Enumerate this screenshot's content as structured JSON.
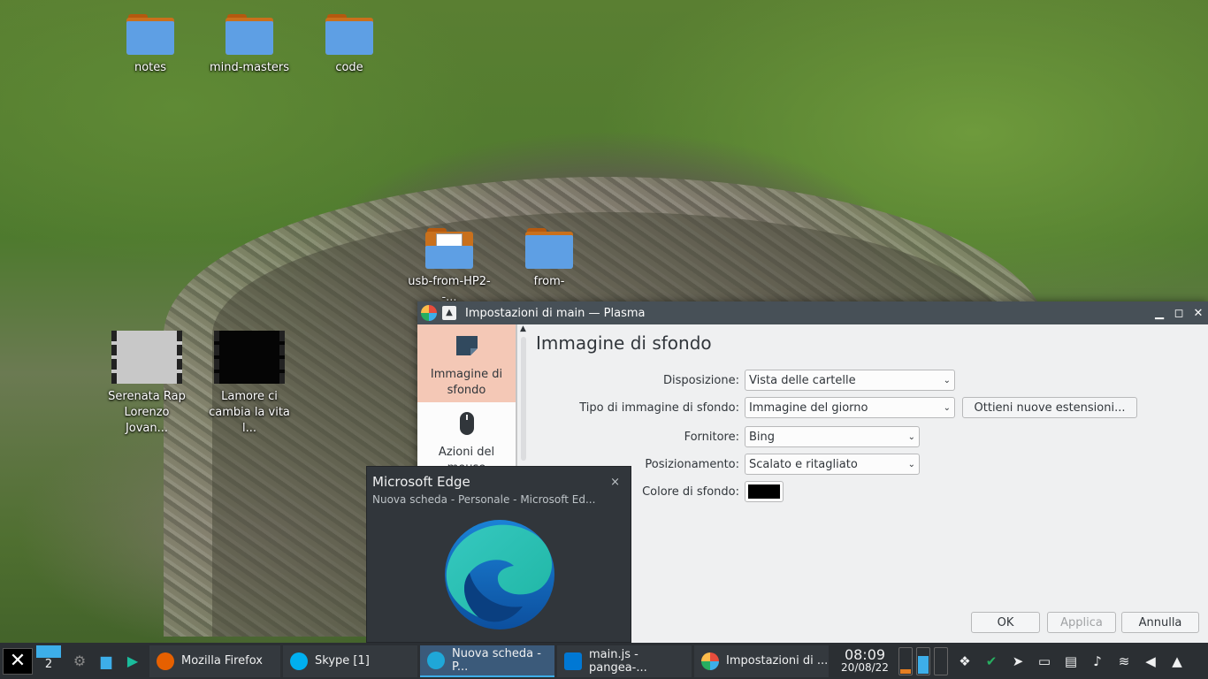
{
  "desktop": {
    "icons": [
      {
        "label": "notes"
      },
      {
        "label": "mind-masters"
      },
      {
        "label": "code"
      },
      {
        "label": "usb-from-HP2--..."
      },
      {
        "label": "from-"
      },
      {
        "label": "Serenata Rap Lorenzo Jovan..."
      },
      {
        "label": "Lamore ci cambia la vita l..."
      }
    ]
  },
  "window": {
    "title": "Impostazioni di main — Plasma",
    "sidebar": [
      {
        "label": "Immagine di sfondo"
      },
      {
        "label": "Azioni del mouse"
      }
    ],
    "heading": "Immagine di sfondo",
    "fields": {
      "layout_label": "Disposizione:",
      "layout_value": "Vista delle cartelle",
      "type_label": "Tipo di immagine di sfondo:",
      "type_value": "Immagine del giorno",
      "get_extensions": "Ottieni nuove estensioni...",
      "provider_label": "Fornitore:",
      "provider_value": "Bing",
      "position_label": "Posizionamento:",
      "position_value": "Scalato e ritagliato",
      "color_label": "Colore di sfondo:",
      "color_value": "#000000"
    },
    "buttons": {
      "ok": "OK",
      "apply": "Applica",
      "cancel": "Annulla"
    }
  },
  "tooltip": {
    "title": "Microsoft Edge",
    "subtitle": "Nuova scheda - Personale - Microsoft Ed...",
    "close": "×"
  },
  "taskbar": {
    "pager_number": "2",
    "tasks": [
      {
        "label": "Mozilla Firefox",
        "color": "#e66000"
      },
      {
        "label": "Skype [1]",
        "color": "#00aff0"
      },
      {
        "label": "Nuova scheda - P...",
        "color": "#1fa7d8"
      },
      {
        "label": "main.js - pangea-...",
        "color": "#0078d4"
      },
      {
        "label": "Impostazioni di ...",
        "color": "#e74c3c"
      }
    ],
    "time": "08:09",
    "date": "20/08/22"
  },
  "colors": {
    "accent": "#3daee9",
    "selection": "#f4c8b6"
  }
}
